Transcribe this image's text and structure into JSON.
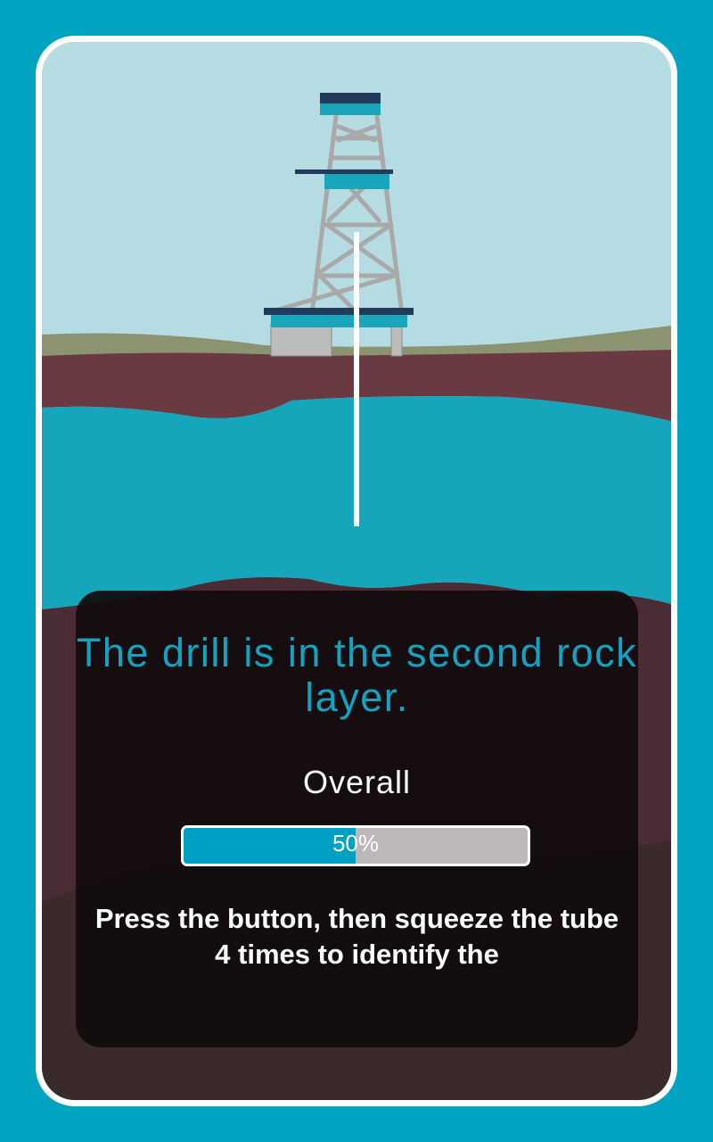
{
  "status": {
    "message": "The drill is in the second rock layer."
  },
  "progress": {
    "label": "Overall",
    "percent": 50,
    "percent_text": "50%"
  },
  "instructions": {
    "text": "Press the button, then squeeze the tube 4 times to identify the"
  },
  "colors": {
    "sky": "#b5dce3",
    "grass": "#8c9370",
    "topsoil": "#6a3a42",
    "water_layer": "#15a6bb",
    "rock_layer": "#4a2c34",
    "deep_rock": "#3b2a2b",
    "accent": "#13a3c1",
    "frame": "#00a3c0"
  }
}
